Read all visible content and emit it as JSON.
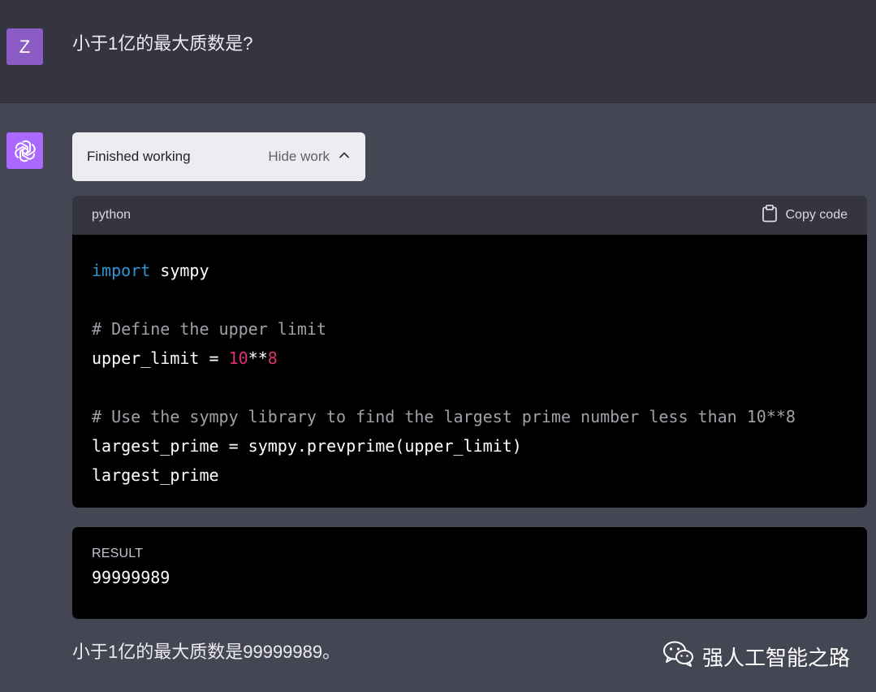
{
  "user": {
    "avatar_letter": "Z",
    "message": "小于1亿的最大质数是?"
  },
  "assistant": {
    "avatar_icon": "openai-logo-icon",
    "work": {
      "status": "Finished working",
      "toggle_label": "Hide work",
      "toggle_icon": "chevron-up-icon"
    },
    "code_block": {
      "language": "python",
      "copy_label": "Copy code",
      "copy_icon": "clipboard-icon",
      "lines": [
        [
          {
            "t": "import",
            "c": "kw"
          },
          {
            "t": " sympy",
            "c": ""
          }
        ],
        [],
        [
          {
            "t": "# Define the upper limit",
            "c": "cmt"
          }
        ],
        [
          {
            "t": "upper_limit = ",
            "c": ""
          },
          {
            "t": "10",
            "c": "num"
          },
          {
            "t": "**",
            "c": ""
          },
          {
            "t": "8",
            "c": "num"
          }
        ],
        [],
        [
          {
            "t": "# Use the sympy library to find the largest prime number less than 10**8",
            "c": "cmt"
          }
        ],
        [
          {
            "t": "largest_prime = sympy.prevprime(upper_limit)",
            "c": ""
          }
        ],
        [
          {
            "t": "largest_prime",
            "c": ""
          }
        ]
      ]
    },
    "result": {
      "label": "RESULT",
      "value": "99999989"
    },
    "answer": "小于1亿的最大质数是99999989。"
  },
  "watermark": {
    "icon": "wechat-icon",
    "text": "强人工智能之路"
  },
  "colors": {
    "user_bg": "#343541",
    "assistant_bg": "#444654",
    "user_avatar": "#8a5cc4",
    "bot_avatar": "#ab68ff",
    "keyword": "#2e95d3",
    "number": "#df3079"
  }
}
